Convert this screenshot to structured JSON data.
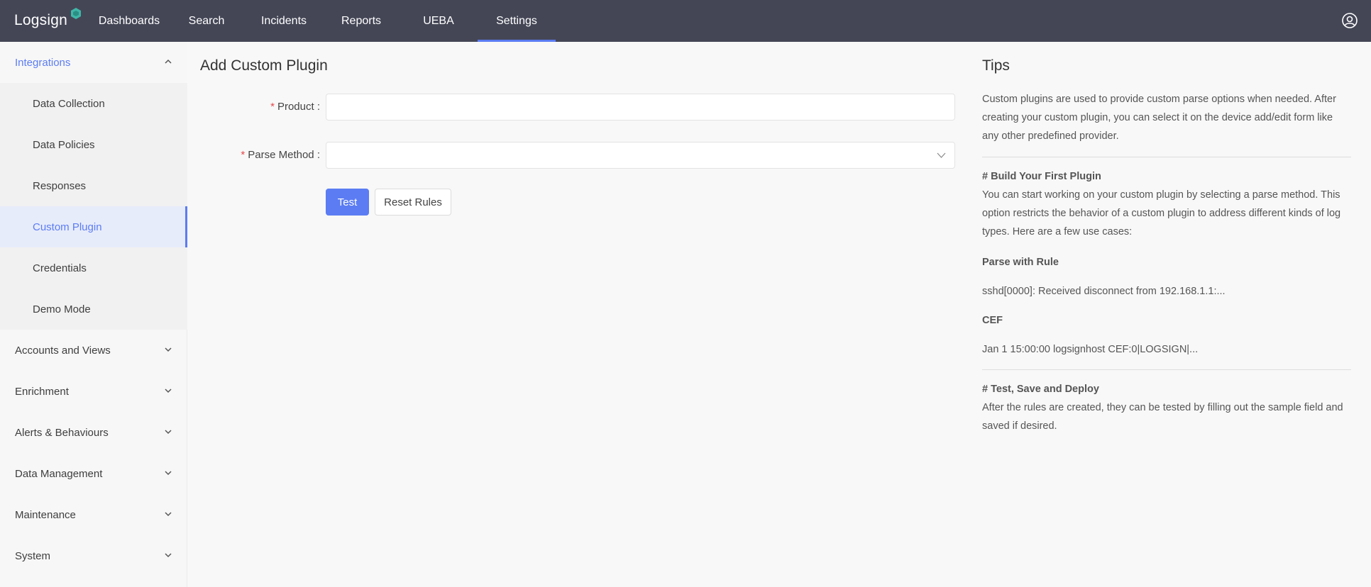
{
  "app": {
    "logo_text": "Logsign"
  },
  "nav": {
    "items": [
      {
        "label": "Dashboards"
      },
      {
        "label": "Search"
      },
      {
        "label": "Incidents"
      },
      {
        "label": "Reports"
      },
      {
        "label": "UEBA"
      },
      {
        "label": "Settings"
      }
    ],
    "active": "Settings"
  },
  "sidebar": {
    "groups": [
      {
        "label": "Integrations",
        "expanded": true
      },
      {
        "label": "Accounts and Views"
      },
      {
        "label": "Enrichment"
      },
      {
        "label": "Alerts & Behaviours"
      },
      {
        "label": "Data Management"
      },
      {
        "label": "Maintenance"
      },
      {
        "label": "System"
      }
    ],
    "integrations_items": [
      {
        "label": "Data Collection"
      },
      {
        "label": "Data Policies"
      },
      {
        "label": "Responses"
      },
      {
        "label": "Custom Plugin"
      },
      {
        "label": "Credentials"
      },
      {
        "label": "Demo Mode"
      }
    ],
    "active_item": "Custom Plugin"
  },
  "form": {
    "title": "Add Custom Plugin",
    "product_label": "Product",
    "product_value": "",
    "parse_method_label": "Parse Method",
    "parse_method_value": "",
    "required_mark": "*",
    "label_suffix": ":",
    "test_button": "Test",
    "reset_button": "Reset Rules"
  },
  "tips": {
    "title": "Tips",
    "intro": "Custom plugins are used to provide custom parse options when needed. After creating your custom plugin, you can select it on the device add/edit form like any other predefined provider.",
    "section1_heading": "# Build Your First Plugin",
    "section1_text": "You can start working on your custom plugin by selecting a parse method. This option restricts the behavior of a custom plugin to address different kinds of log types. Here are a few use cases:",
    "rule_heading": "Parse with Rule",
    "rule_example": "sshd[0000]: Received disconnect from 192.168.1.1:...",
    "cef_heading": "CEF",
    "cef_example": "Jan 1 15:00:00 logsignhost CEF:0|LOGSIGN|...",
    "section2_heading": "# Test, Save and Deploy",
    "section2_text": "After the rules are created, they can be tested by filling out the sample field and saved if desired."
  },
  "colors": {
    "topbar": "#444656",
    "accent": "#5b7cf3",
    "required": "#e5484d"
  }
}
